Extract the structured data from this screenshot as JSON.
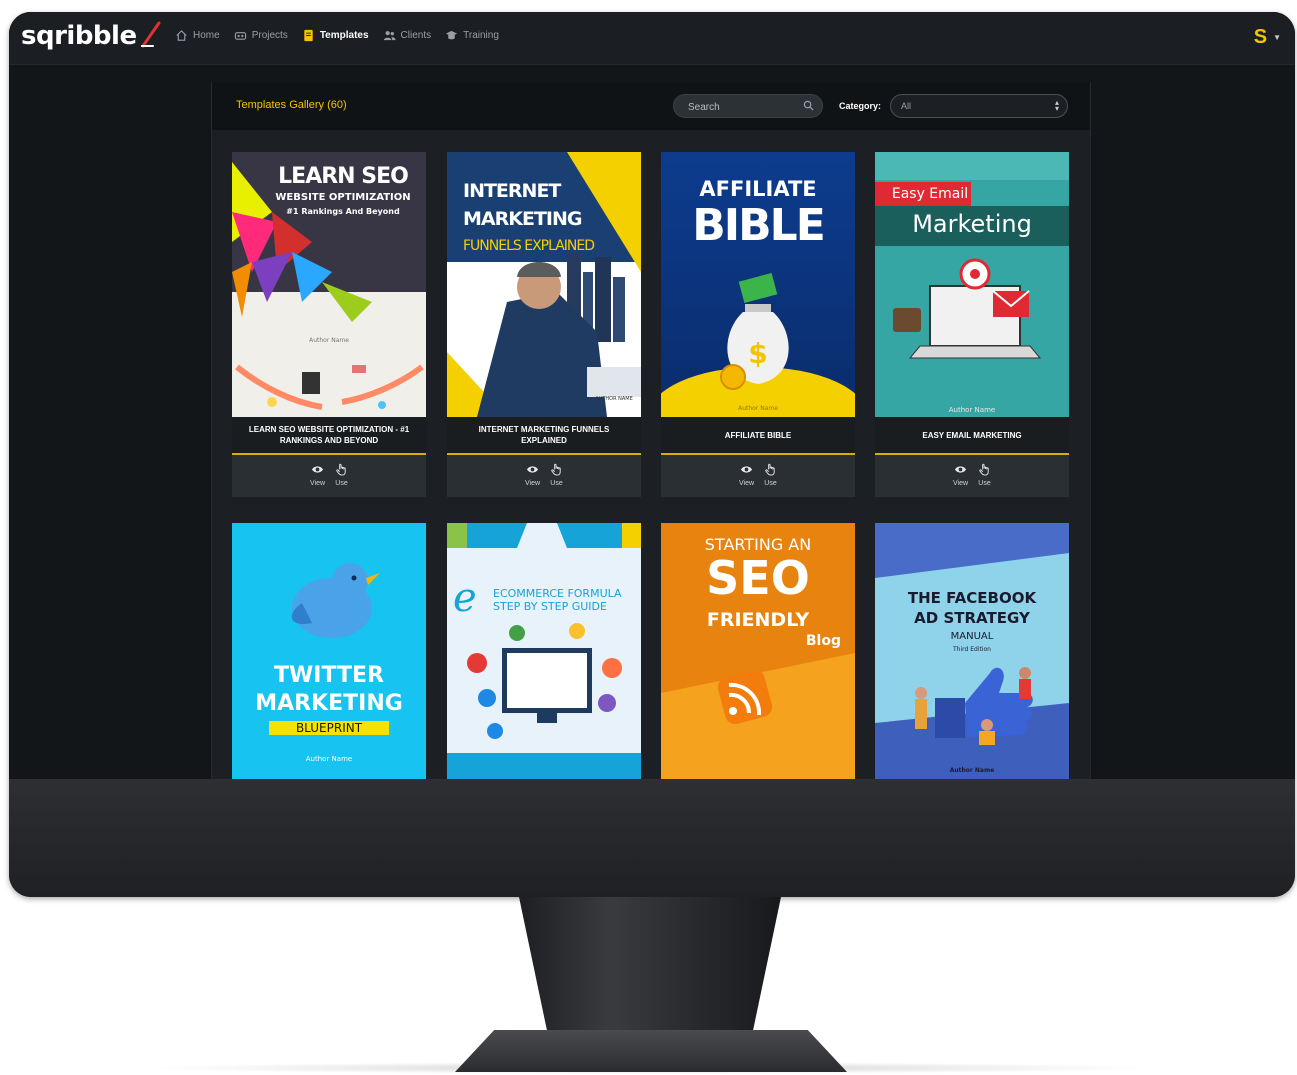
{
  "app": {
    "logo_text": "sqribble",
    "user_initial": "S"
  },
  "nav": [
    {
      "label": "Home",
      "icon": "home-icon"
    },
    {
      "label": "Projects",
      "icon": "projects-icon"
    },
    {
      "label": "Templates",
      "icon": "templates-icon"
    },
    {
      "label": "Clients",
      "icon": "clients-icon"
    },
    {
      "label": "Training",
      "icon": "training-icon"
    }
  ],
  "gallery": {
    "title": "Templates Gallery (60)",
    "search_placeholder": "Search",
    "category_label": "Category:",
    "category_value": "All",
    "view_label": "View",
    "use_label": "Use"
  },
  "templates": [
    {
      "title": "LEARN SEO WEBSITE OPTIMIZATION - #1 RANKINGS AND BEYOND",
      "cover": {
        "line1": "LEARN SEO",
        "line2": "WEBSITE OPTIMIZATION",
        "line3": "#1 Rankings And Beyond",
        "author": "Author Name"
      }
    },
    {
      "title": "INTERNET MARKETING FUNNELS EXPLAINED",
      "cover": {
        "line1": "INTERNET",
        "line2": "MARKETING",
        "line3": "FUNNELS EXPLAINED",
        "author": "AUTHOR NAME"
      }
    },
    {
      "title": "AFFILIATE BIBLE",
      "cover": {
        "line1": "AFFILIATE",
        "line2": "BIBLE",
        "author": "Author Name"
      }
    },
    {
      "title": "EASY EMAIL MARKETING",
      "cover": {
        "line1": "Easy Email",
        "line2": "Marketing",
        "author": "Author Name"
      }
    },
    {
      "cover": {
        "line1": "TWITTER",
        "line2": "MARKETING",
        "line3": "BLUEPRINT",
        "author": "Author Name"
      }
    },
    {
      "cover": {
        "line1": "ECOMMERCE FORMULA",
        "line2": "STEP BY STEP GUIDE"
      }
    },
    {
      "cover": {
        "line1": "STARTING AN",
        "line2": "SEO",
        "line3": "FRIENDLY",
        "line4": "Blog"
      }
    },
    {
      "cover": {
        "line1": "THE FACEBOOK",
        "line2": "AD STRATEGY",
        "line3": "MANUAL",
        "line4": "Third Edition",
        "author": "Author Name"
      }
    }
  ],
  "colors": {
    "accent": "#f5c400",
    "background": "#131619",
    "panel": "#1c2024"
  }
}
